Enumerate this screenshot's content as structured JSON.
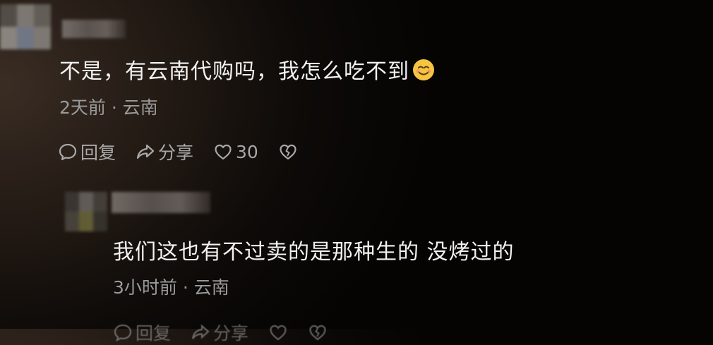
{
  "comments": [
    {
      "text": "不是，有云南代购吗，我怎么吃不到",
      "emoji": "smiling-face-emoji",
      "meta": "2天前 · 云南",
      "reply_label": "回复",
      "share_label": "分享",
      "like_count": "30"
    },
    {
      "text": "我们这也有不过卖的是那种生的 没烤过的",
      "meta": "3小时前 · 云南",
      "reply_label": "回复",
      "share_label": "分享"
    }
  ],
  "icons": {
    "reply": "comment-bubble-icon",
    "share": "share-arrow-icon",
    "like": "heart-outline-icon",
    "dislike": "broken-heart-icon"
  },
  "colors": {
    "text_primary": "#f2f2f2",
    "text_secondary": "#9a9a9a",
    "icon": "#a8a8a8",
    "emoji_yellow": "#f5c542"
  }
}
